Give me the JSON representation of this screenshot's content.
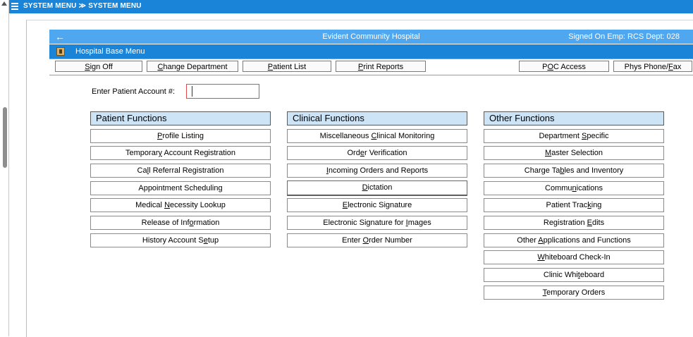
{
  "topbar": {
    "crumb_pre": "SYSTEM MENU",
    "sep": "≫",
    "crumb_post": "SYSTEM MENU"
  },
  "header": {
    "hospital": "Evident Community Hospital",
    "signed_on": "Signed On Emp: RCS  Dept: 028",
    "menu_title": "Hospital Base Menu"
  },
  "menubar": {
    "buttons": [
      {
        "pre": "",
        "u": "S",
        "post": "ign Off"
      },
      {
        "pre": "",
        "u": "C",
        "post": "hange Department"
      },
      {
        "pre": "",
        "u": "P",
        "post": "atient List"
      },
      {
        "pre": "",
        "u": "P",
        "post": "rint Reports"
      },
      {
        "pre": "P",
        "u": "O",
        "post": "C Access"
      },
      {
        "pre": "Phys Phone/",
        "u": "F",
        "post": "ax"
      }
    ]
  },
  "account": {
    "label": "Enter Patient Account #:",
    "value": ""
  },
  "columns": [
    {
      "title": "Patient Functions",
      "items": [
        {
          "pre": "",
          "u": "P",
          "post": "rofile Listing"
        },
        {
          "pre": "Temporar",
          "u": "y",
          "post": " Account Registration"
        },
        {
          "pre": "Ca",
          "u": "l",
          "post": "l Referral Registration"
        },
        {
          "pre": "Appointment Schedulin",
          "u": "g",
          "post": ""
        },
        {
          "pre": "Medical ",
          "u": "N",
          "post": "ecessity Lookup"
        },
        {
          "pre": "Release of Inf",
          "u": "o",
          "post": "rmation"
        },
        {
          "pre": "History Account S",
          "u": "e",
          "post": "tup"
        }
      ]
    },
    {
      "title": "Clinical Functions",
      "items": [
        {
          "pre": "Miscellaneous ",
          "u": "C",
          "post": "linical Monitoring"
        },
        {
          "pre": "Ord",
          "u": "e",
          "post": "r Verification"
        },
        {
          "pre": "",
          "u": "I",
          "post": "ncoming Orders and Reports"
        },
        {
          "pre": "",
          "u": "D",
          "post": "ictation"
        },
        {
          "pre": "",
          "u": "E",
          "post": "lectronic Signature"
        },
        {
          "pre": "Electronic Signature for ",
          "u": "I",
          "post": "mages"
        },
        {
          "pre": "Enter ",
          "u": "O",
          "post": "rder Number"
        }
      ]
    },
    {
      "title": "Other Functions",
      "items": [
        {
          "pre": "Department ",
          "u": "S",
          "post": "pecific"
        },
        {
          "pre": "",
          "u": "M",
          "post": "aster Selection"
        },
        {
          "pre": "Charge Ta",
          "u": "b",
          "post": "les and Inventory"
        },
        {
          "pre": "Commu",
          "u": "n",
          "post": "ications"
        },
        {
          "pre": "Patient Trac",
          "u": "k",
          "post": "ing"
        },
        {
          "pre": "Registration ",
          "u": "E",
          "post": "dits"
        },
        {
          "pre": "Other ",
          "u": "A",
          "post": "pplications and Functions"
        },
        {
          "pre": "",
          "u": "W",
          "post": "hiteboard Check-In"
        },
        {
          "pre": "Clinic Whi",
          "u": "t",
          "post": "eboard"
        },
        {
          "pre": "",
          "u": "T",
          "post": "emporary Orders"
        }
      ]
    }
  ]
}
